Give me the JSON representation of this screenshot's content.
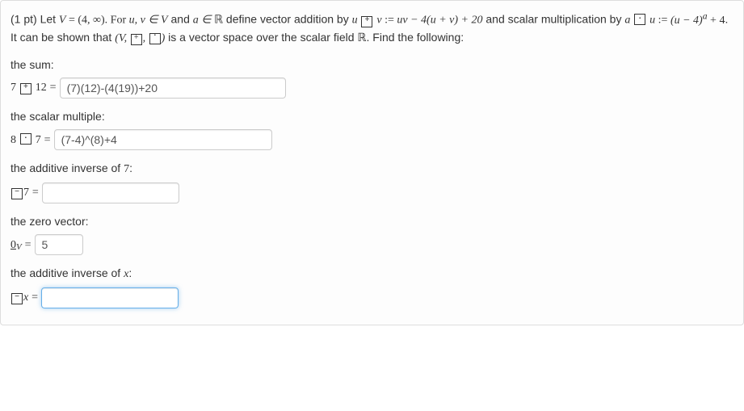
{
  "prompt": {
    "points_prefix": "(1 pt) Let ",
    "V_eq": "V",
    "eq1": " = (4, ∞). For ",
    "uv": "u, v ∈ V",
    "and": " and ",
    "a_in": "a ∈ ",
    "R": "ℝ",
    "def_add": " define vector addition by ",
    "u": "u",
    "boxplus": "⊞",
    "v": "v",
    "assign": " := ",
    "rhs_add": "uv − 4(u + v) + 20",
    "and_scalar": " and scalar multiplication by ",
    "a": "a",
    "boxdot": "⊡",
    "rhs_scalar_pre": "(u − 4)",
    "rhs_scalar_exp": "a",
    "rhs_scalar_post": " + 4",
    "shown": ". It can be shown that ",
    "triple": "(V, ⊞, ⊡)",
    "over": " is a vector space over the scalar field ",
    "find": ". Find the following:"
  },
  "labels": {
    "sum": "the sum:",
    "scalar": "the scalar multiple:",
    "inv7": "the additive inverse of 7:",
    "zero": "the zero vector:",
    "invx": "the additive inverse of x:"
  },
  "rows": {
    "sum_lhs_a": "7",
    "sum_lhs_b": "12",
    "sum_val": "(7)(12)-(4(19))+20",
    "scalar_lhs_a": "8",
    "scalar_lhs_b": "7",
    "scalar_val": "(7-4)^(8)+4",
    "inv7_rhs": "7",
    "inv7_val": "",
    "zero_sym": "0",
    "zero_sub": "V",
    "zero_val": "5",
    "invx_rhs": "x",
    "invx_val": ""
  }
}
